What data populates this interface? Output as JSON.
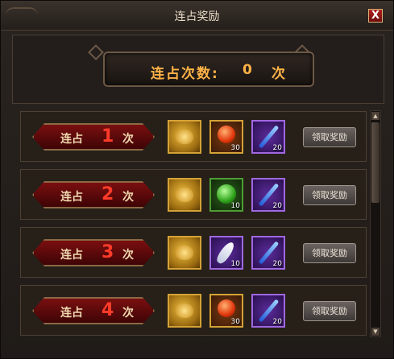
{
  "window": {
    "title": "连占奖励",
    "close_label": "X"
  },
  "counter": {
    "label": "连占次数:",
    "value": "0",
    "unit": "次"
  },
  "rows": [
    {
      "prefix": "连占",
      "number": "1",
      "suffix": "次",
      "rewards": [
        {
          "icon": "gold-ingot-icon",
          "style": "gold",
          "count": ""
        },
        {
          "icon": "fire-orb-icon",
          "style": "orange",
          "count": "30"
        },
        {
          "icon": "blue-potion-icon",
          "style": "purple",
          "count": "20"
        }
      ],
      "button": "领取奖励"
    },
    {
      "prefix": "连占",
      "number": "2",
      "suffix": "次",
      "rewards": [
        {
          "icon": "gold-ingot-icon",
          "style": "gold",
          "count": ""
        },
        {
          "icon": "green-orb-icon",
          "style": "green",
          "count": "10"
        },
        {
          "icon": "blue-potion-icon",
          "style": "purple",
          "count": "20"
        }
      ],
      "button": "领取奖励"
    },
    {
      "prefix": "连占",
      "number": "3",
      "suffix": "次",
      "rewards": [
        {
          "icon": "gold-ingot-icon",
          "style": "gold",
          "count": ""
        },
        {
          "icon": "white-feather-icon",
          "style": "purple",
          "count": "10"
        },
        {
          "icon": "blue-potion-icon",
          "style": "purple",
          "count": "20"
        }
      ],
      "button": "领取奖励"
    },
    {
      "prefix": "连占",
      "number": "4",
      "suffix": "次",
      "rewards": [
        {
          "icon": "gold-ingot-icon",
          "style": "gold",
          "count": ""
        },
        {
          "icon": "fire-orb-icon",
          "style": "orange",
          "count": "30"
        },
        {
          "icon": "blue-potion-icon",
          "style": "purple",
          "count": "20"
        }
      ],
      "button": "领取奖励"
    }
  ],
  "colors": {
    "accent": "#ffb347",
    "number_red": "#ff3b2a",
    "frame_gold": "#d4a236"
  }
}
